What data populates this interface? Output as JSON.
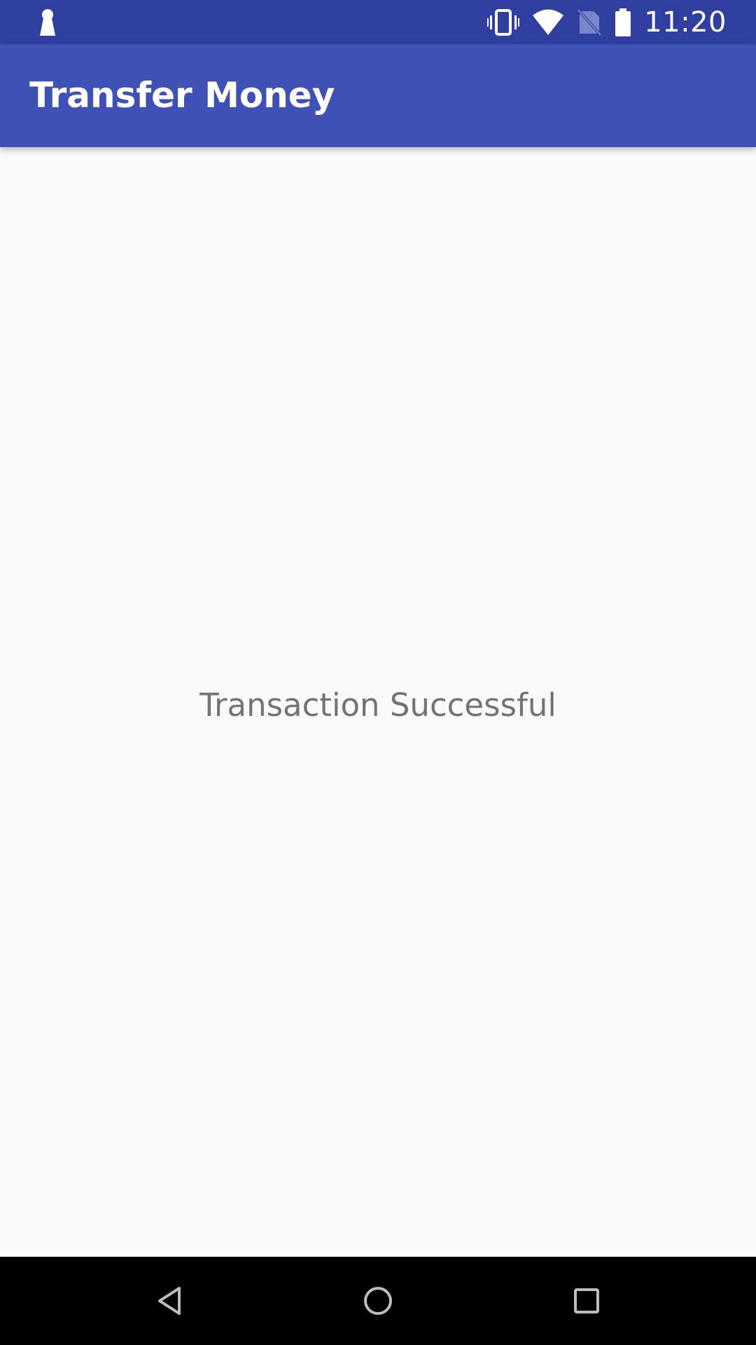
{
  "status_bar": {
    "time": "11:20",
    "left_icon": "keyhole-icon",
    "icons": [
      "vibrate-icon",
      "wifi-icon",
      "no-sim-icon",
      "battery-icon"
    ],
    "bg_color": "#303f9f"
  },
  "app_bar": {
    "title": "Transfer Money",
    "bg_color": "#3f51b5"
  },
  "content": {
    "message": "Transaction Successful",
    "text_color": "#737373",
    "bg_color": "#fafafa"
  },
  "nav_bar": {
    "buttons": [
      "back-icon",
      "home-icon",
      "recents-icon"
    ]
  }
}
